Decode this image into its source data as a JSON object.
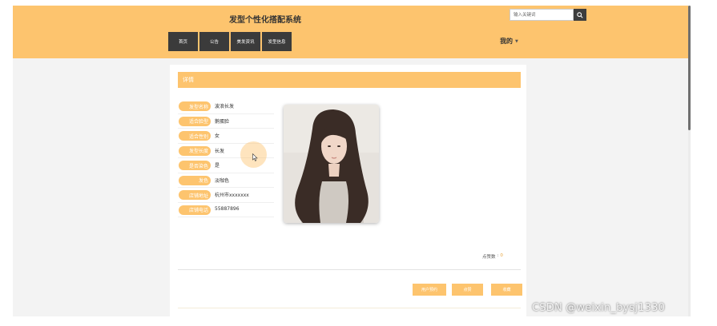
{
  "header": {
    "site_title": "发型个性化搭配系统",
    "search_placeholder": "输入关键词",
    "user_menu_label": "我的"
  },
  "nav": {
    "items": [
      {
        "label": "首页"
      },
      {
        "label": "公告"
      },
      {
        "label": "美发资讯"
      },
      {
        "label": "发型信息"
      }
    ]
  },
  "detail": {
    "section_title": "详情",
    "fields": [
      {
        "label": "发型名称",
        "value": "波浪长发"
      },
      {
        "label": "适合脸型",
        "value": "鹅蛋脸"
      },
      {
        "label": "适合性别",
        "value": "女"
      },
      {
        "label": "发型长度",
        "value": "长发"
      },
      {
        "label": "是否染色",
        "value": "是"
      },
      {
        "label": "发色",
        "value": "淡咖色"
      },
      {
        "label": "店铺地址",
        "value": "杭州市xxxxxxx"
      },
      {
        "label": "店铺电话",
        "value": "55887896"
      }
    ],
    "likes_label": "点赞数",
    "likes_separator": ":",
    "likes_count": "0"
  },
  "actions": {
    "book_label": "用户预约",
    "like_label": "点赞",
    "favorite_label": "收藏"
  },
  "watermark": "CSDN @weixin_bysj1330",
  "colors": {
    "accent": "#fdc46e",
    "nav_bg": "#3b3b3b",
    "page_bg": "#f3f3f3"
  }
}
